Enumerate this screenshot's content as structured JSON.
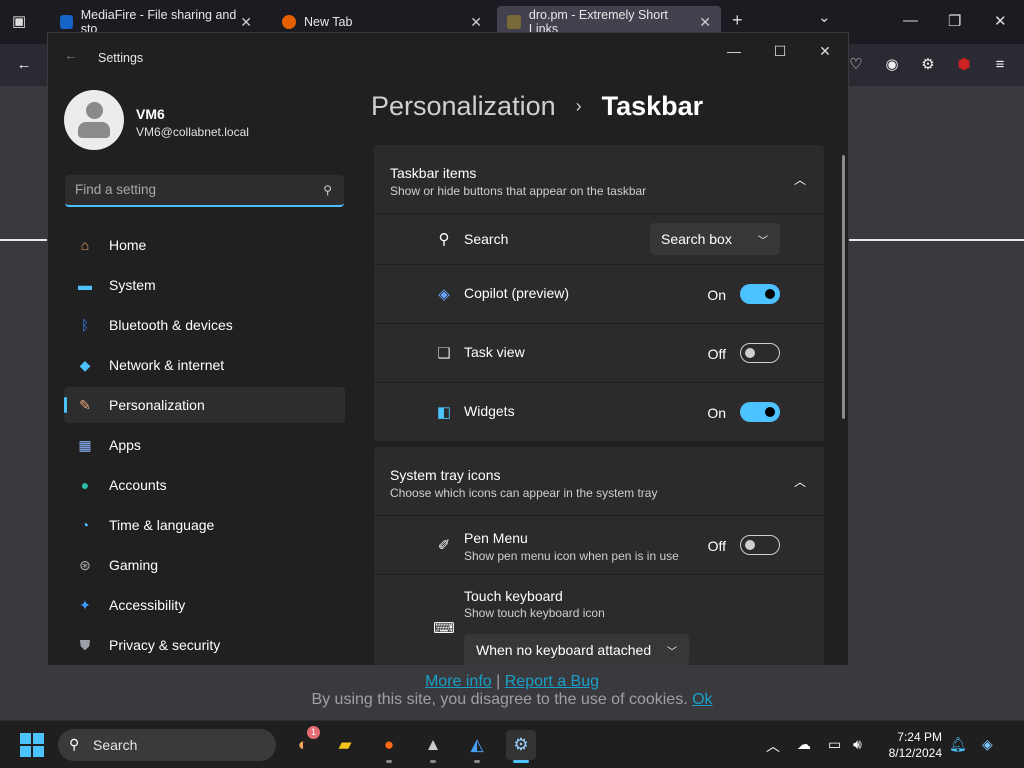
{
  "browser": {
    "tabs": [
      {
        "title": "MediaFire - File sharing and sto"
      },
      {
        "title": "New Tab"
      },
      {
        "title": "dro.pm - Extremely Short Links"
      }
    ],
    "new_tab": "+",
    "tab_overflow": "⌄"
  },
  "page": {
    "cookie_links": {
      "more_info": "More info",
      "sep": "|",
      "report": "Report a Bug"
    },
    "cookie_text": "By using this site, you disagree to the use of cookies.",
    "cookie_ok": "Ok"
  },
  "settings": {
    "window_title": "Settings",
    "profile": {
      "name": "VM6",
      "email": "VM6@collabnet.local"
    },
    "search_placeholder": "Find a setting",
    "nav": [
      {
        "label": "Home",
        "icon": "home-icon",
        "color": "#f4a261"
      },
      {
        "label": "System",
        "icon": "system-icon",
        "color": "#4cc2ff"
      },
      {
        "label": "Bluetooth & devices",
        "icon": "bluetooth-icon",
        "color": "#3b82f6"
      },
      {
        "label": "Network & internet",
        "icon": "network-icon",
        "color": "#4cc2ff"
      },
      {
        "label": "Personalization",
        "icon": "brush-icon",
        "color": "#e8a87c"
      },
      {
        "label": "Apps",
        "icon": "apps-icon",
        "color": "#8ab4f8"
      },
      {
        "label": "Accounts",
        "icon": "accounts-icon",
        "color": "#2bc0a6"
      },
      {
        "label": "Time & language",
        "icon": "time-language-icon",
        "color": "#4cc2ff"
      },
      {
        "label": "Gaming",
        "icon": "gaming-icon",
        "color": "#b0b0b0"
      },
      {
        "label": "Accessibility",
        "icon": "accessibility-icon",
        "color": "#3b9cff"
      },
      {
        "label": "Privacy & security",
        "icon": "shield-icon",
        "color": "#9aa0a6"
      }
    ],
    "selected_nav": "Personalization",
    "breadcrumb": {
      "parent": "Personalization",
      "sep": "›",
      "current": "Taskbar"
    },
    "taskbar_items": {
      "title": "Taskbar items",
      "subtitle": "Show or hide buttons that appear on the taskbar",
      "rows": {
        "search": {
          "label": "Search",
          "value": "Search box"
        },
        "copilot": {
          "label": "Copilot (preview)",
          "state": "On"
        },
        "taskview": {
          "label": "Task view",
          "state": "Off"
        },
        "widgets": {
          "label": "Widgets",
          "state": "On"
        }
      }
    },
    "system_tray": {
      "title": "System tray icons",
      "subtitle": "Choose which icons can appear in the system tray",
      "rows": {
        "pen": {
          "label": "Pen Menu",
          "sub": "Show pen menu icon when pen is in use",
          "state": "Off"
        },
        "touch": {
          "label": "Touch keyboard",
          "sub": "Show touch keyboard icon",
          "value": "When no keyboard attached"
        }
      }
    },
    "accent_color": "#4cc2ff"
  },
  "taskbar": {
    "search_label": "Search",
    "time": "7:24 PM",
    "date": "8/12/2024",
    "badge_count": "1"
  }
}
